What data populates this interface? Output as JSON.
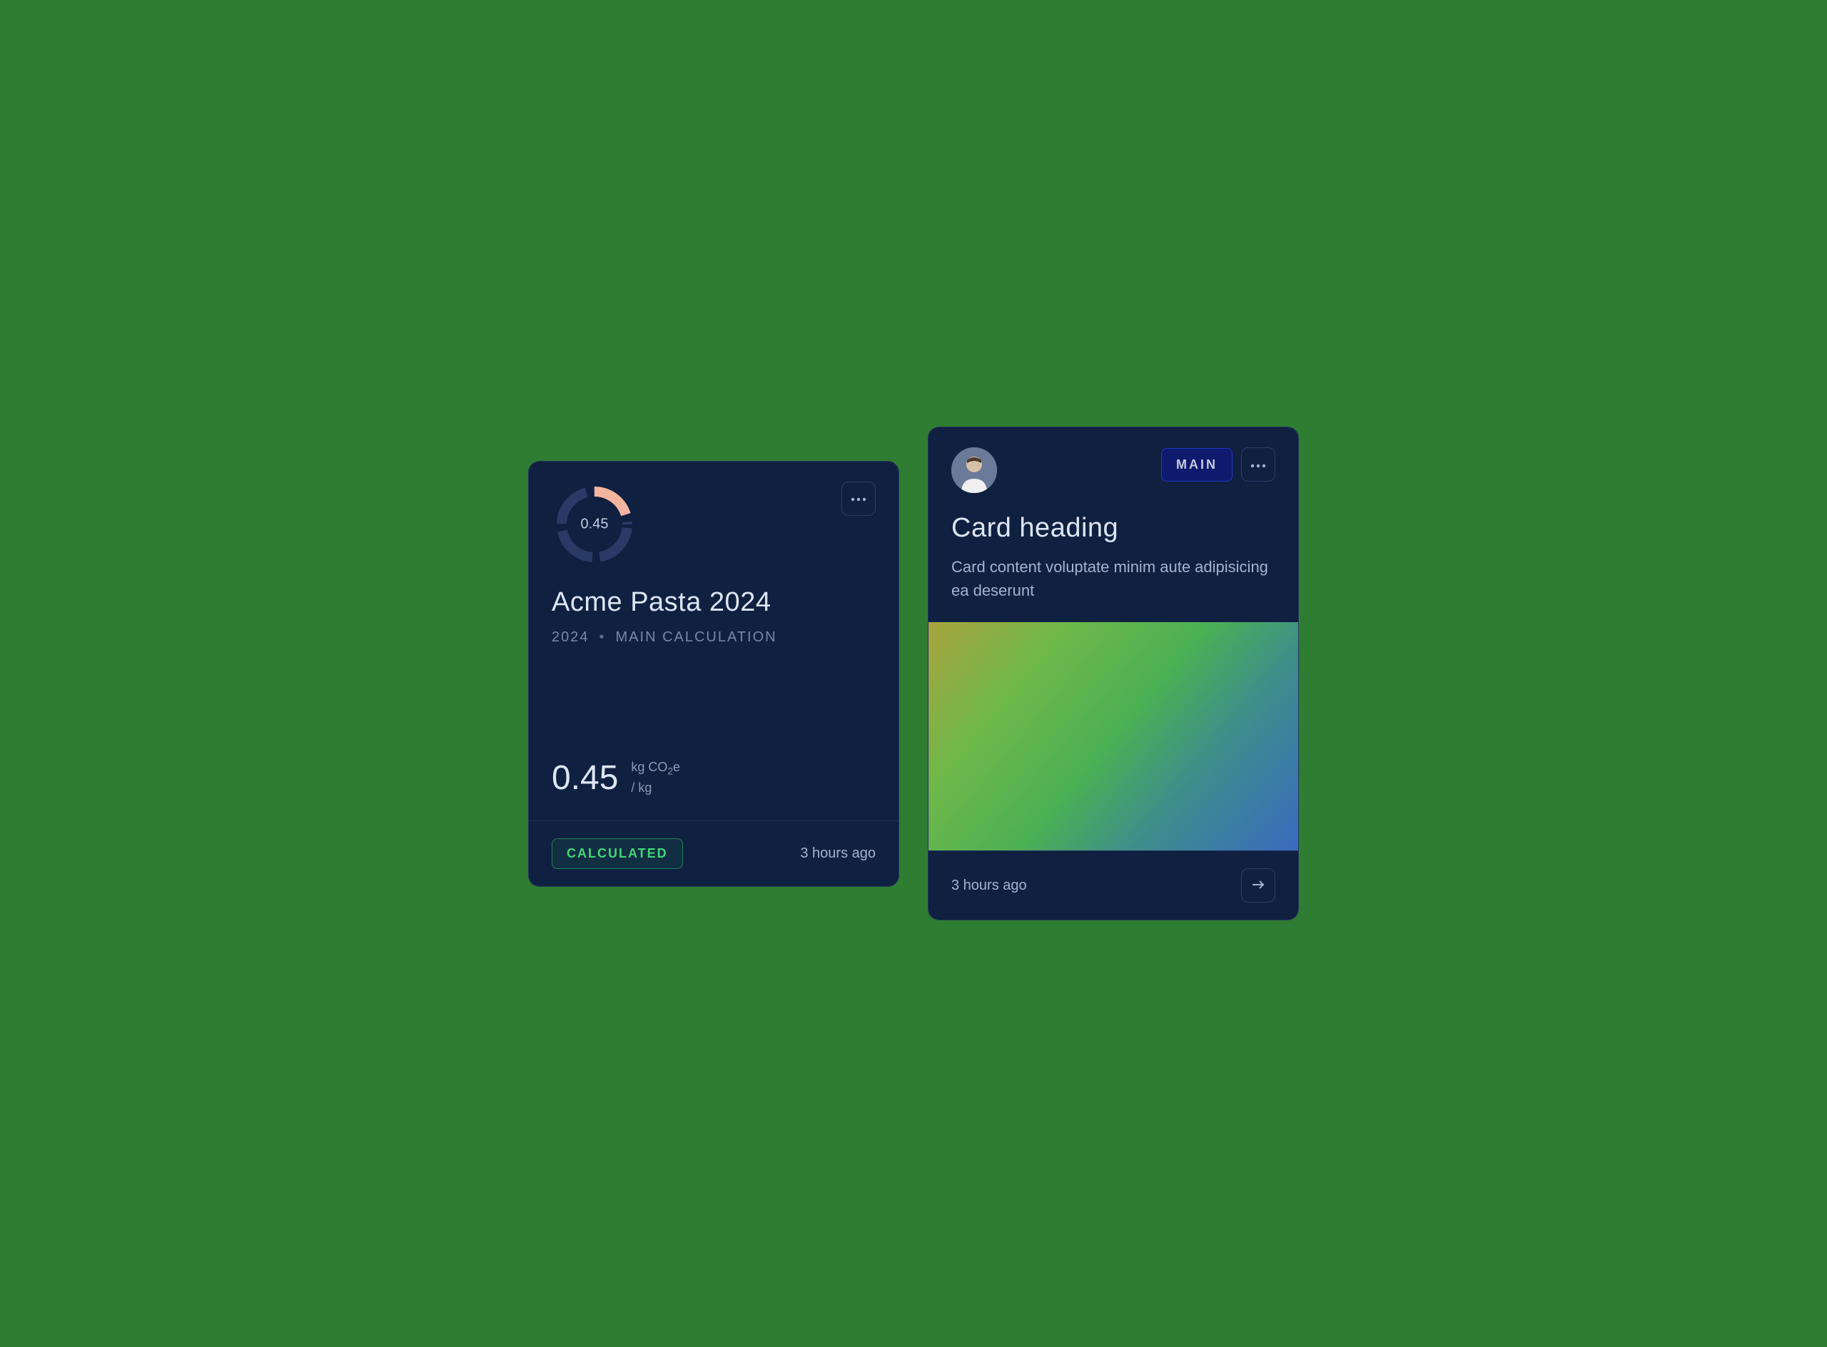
{
  "card1": {
    "donut": {
      "value": "0.45",
      "progress": 0.45
    },
    "title": "Acme Pasta 2024",
    "year": "2024",
    "subtitle": "MAIN CALCULATION",
    "metric": {
      "value": "0.45",
      "unit_line1": "kg CO₂e",
      "unit_line2": "/ kg"
    },
    "status": "CALCULATED",
    "timestamp": "3 hours ago"
  },
  "card2": {
    "badge": "MAIN",
    "title": "Card heading",
    "description": "Card content voluptate minim aute adipisicing ea deserunt",
    "timestamp": "3 hours ago"
  }
}
